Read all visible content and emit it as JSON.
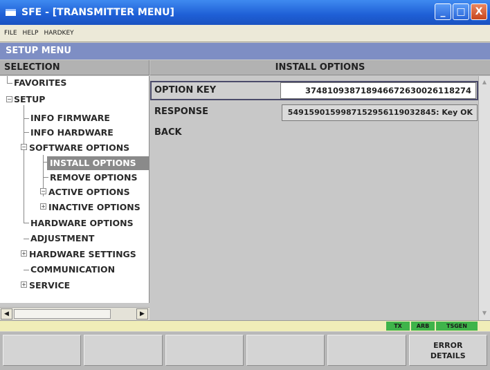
{
  "window": {
    "title": "SFE - [TRANSMITTER MENU]",
    "buttons": {
      "minimize": "_",
      "maximize": "□",
      "close": "X"
    }
  },
  "menubar": [
    "FILE",
    "HELP",
    "HARDKEY"
  ],
  "setup_header": "SETUP MENU",
  "left_header": "SELECTION",
  "right_header": "INSTALL OPTIONS",
  "tree": [
    {
      "label": "FAVORITES"
    },
    {
      "label": "SETUP"
    },
    {
      "label": "INFO FIRMWARE"
    },
    {
      "label": "INFO HARDWARE"
    },
    {
      "label": "SOFTWARE OPTIONS"
    },
    {
      "label": "INSTALL OPTIONS",
      "selected": true
    },
    {
      "label": "REMOVE OPTIONS"
    },
    {
      "label": "ACTIVE OPTIONS"
    },
    {
      "label": "INACTIVE OPTIONS"
    },
    {
      "label": "HARDWARE OPTIONS"
    },
    {
      "label": "ADJUSTMENT"
    },
    {
      "label": "HARDWARE SETTINGS"
    },
    {
      "label": "COMMUNICATION"
    },
    {
      "label": "SERVICE"
    }
  ],
  "content": {
    "option_key_label": "OPTION KEY",
    "option_key_value": "374810938718946672630026118274",
    "response_label": "RESPONSE",
    "response_value": "549159015998715295611903284​5: Key OK",
    "back_label": "BACK"
  },
  "status": {
    "tx": "TX",
    "arb": "ARB",
    "tsgen": "TSGEN"
  },
  "softkeys": [
    "",
    "",
    "",
    "",
    "",
    "ERROR\nDETAILS"
  ]
}
